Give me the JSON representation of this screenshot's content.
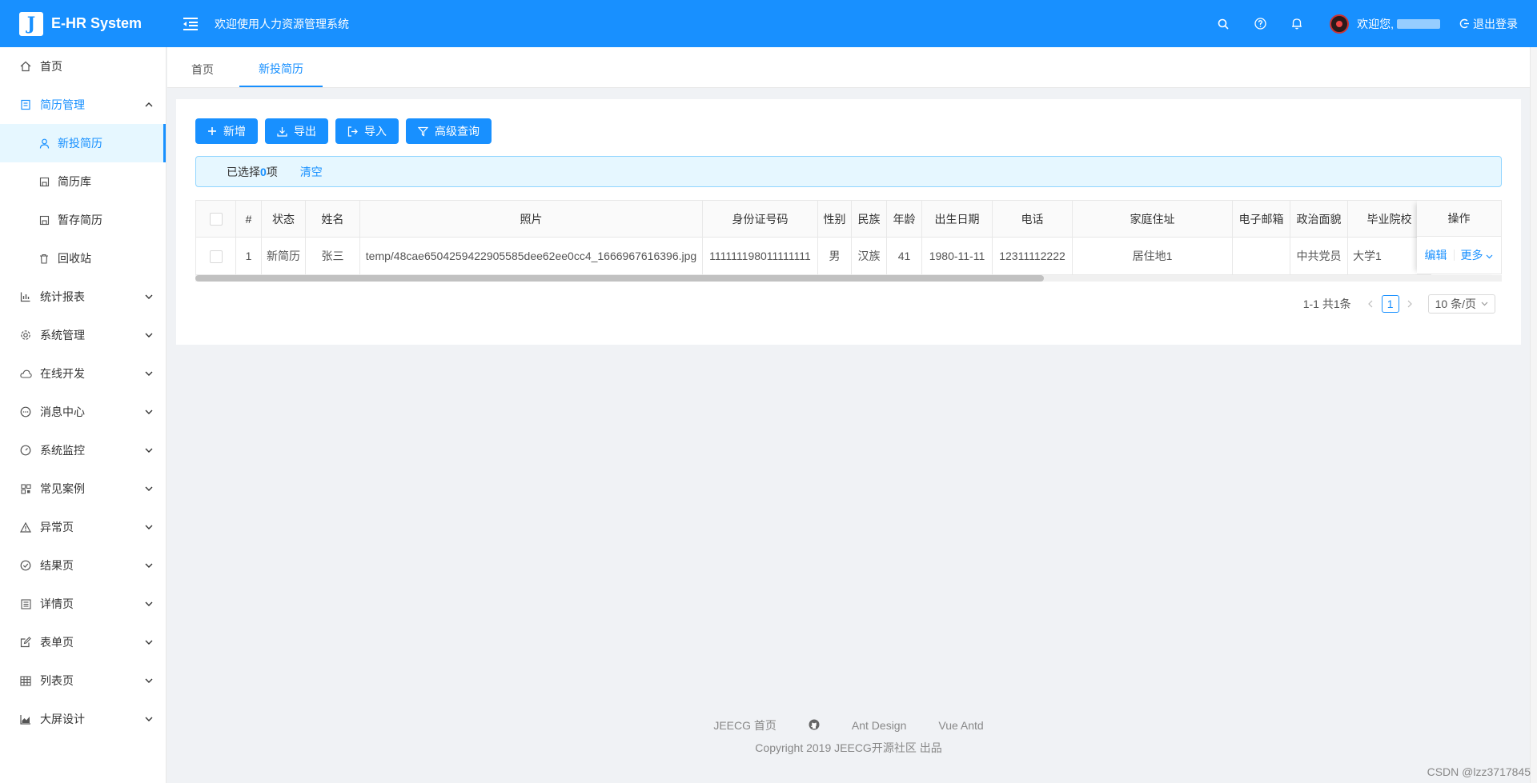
{
  "header": {
    "logo_letter": "J",
    "app_title": "E-HR System",
    "subtitle": "欢迎使用人力资源管理系统",
    "welcome": "欢迎您,",
    "logout": "退出登录"
  },
  "sidebar": {
    "items": [
      {
        "label": "首页",
        "icon": "home-icon"
      },
      {
        "label": "简历管理",
        "icon": "resume-icon"
      },
      {
        "label": "统计报表",
        "icon": "bar-chart-icon"
      },
      {
        "label": "系统管理",
        "icon": "gear-icon"
      },
      {
        "label": "在线开发",
        "icon": "cloud-icon"
      },
      {
        "label": "消息中心",
        "icon": "message-icon"
      },
      {
        "label": "系统监控",
        "icon": "dashboard-icon"
      },
      {
        "label": "常见案例",
        "icon": "qrcode-icon"
      },
      {
        "label": "异常页",
        "icon": "warning-icon"
      },
      {
        "label": "结果页",
        "icon": "check-circle-icon"
      },
      {
        "label": "详情页",
        "icon": "profile-icon"
      },
      {
        "label": "表单页",
        "icon": "form-icon"
      },
      {
        "label": "列表页",
        "icon": "table-icon"
      },
      {
        "label": "大屏设计",
        "icon": "area-chart-icon"
      }
    ],
    "sub_items": [
      {
        "label": "新投简历",
        "icon": "user-icon"
      },
      {
        "label": "简历库",
        "icon": "save-icon"
      },
      {
        "label": "暂存简历",
        "icon": "save-icon"
      },
      {
        "label": "回收站",
        "icon": "trash-icon"
      }
    ]
  },
  "tabs": [
    "首页",
    "新投简历"
  ],
  "toolbar": {
    "add": "新增",
    "export": "导出",
    "import": "导入",
    "advanced_query": "高级查询"
  },
  "selection": {
    "prefix": "已选择",
    "count": "0",
    "suffix": "项",
    "clear": "清空"
  },
  "table": {
    "columns": [
      "#",
      "状态",
      "姓名",
      "照片",
      "身份证号码",
      "性别",
      "民族",
      "年龄",
      "出生日期",
      "电话",
      "家庭住址",
      "电子邮箱",
      "政治面貌",
      "毕业院校"
    ],
    "op_header": "操作",
    "rows": [
      [
        "1",
        "新简历",
        "张三",
        "temp/48cae6504259422905585dee62ee0cc4_1666967616396.jpg",
        "111111198011111111",
        "男",
        "汉族",
        "41",
        "1980-11-11",
        "12311112222",
        "居住地1",
        "",
        "中共党员",
        "大学1"
      ]
    ],
    "edit": "编辑",
    "more": "更多"
  },
  "pagination": {
    "total": "1-1 共1条",
    "current": "1",
    "page_size": "10 条/页"
  },
  "footer": {
    "links": [
      "JEECG 首页",
      "Ant Design",
      "Vue Antd"
    ],
    "copyright": "Copyright  2019 JEECG开源社区 出品"
  },
  "watermark": "CSDN @lzz3717845",
  "colors": {
    "primary": "#1890ff",
    "alert_bg": "#e6f7ff",
    "page_bg": "#f0f2f5"
  }
}
